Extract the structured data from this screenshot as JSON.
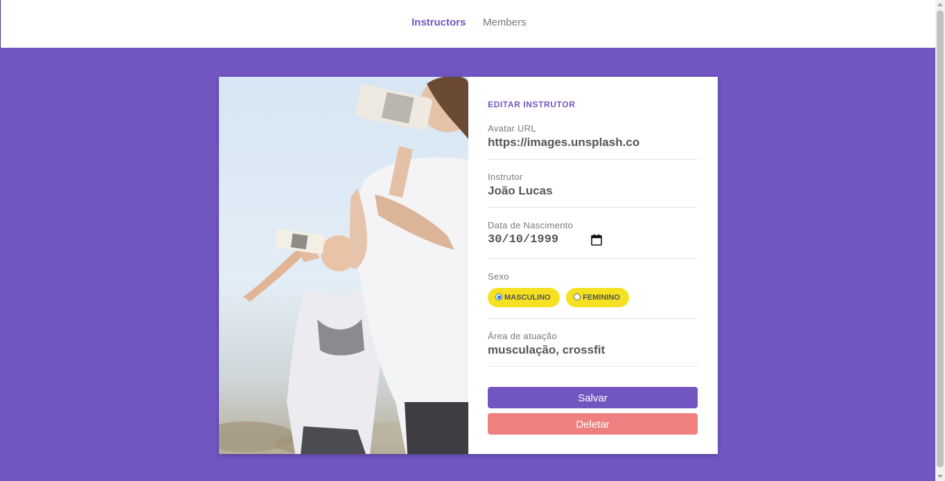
{
  "nav": {
    "items": [
      {
        "label": "Instructors",
        "active": true
      },
      {
        "label": "Members",
        "active": false
      }
    ]
  },
  "colors": {
    "accent": "#7156c2",
    "background": "#7156c2",
    "radio_pill": "#f5e121",
    "delete": "#f08080"
  },
  "form": {
    "title": "EDITAR INSTRUTOR",
    "avatar": {
      "label": "Avatar URL",
      "value": "https://images.unsplash.com"
    },
    "name": {
      "label": "Instrutor",
      "value": "João Lucas"
    },
    "birth": {
      "label": "Data de Nascimento",
      "value": "30/10/1999",
      "icon": "calendar-icon"
    },
    "gender": {
      "label": "Sexo",
      "options": [
        {
          "label": "MASCULINO",
          "checked": true
        },
        {
          "label": "FEMININO",
          "checked": false
        }
      ]
    },
    "area": {
      "label": "Área de atuação",
      "value": "musculação, crossfit"
    },
    "save_label": "Salvar",
    "delete_label": "Deletar"
  }
}
